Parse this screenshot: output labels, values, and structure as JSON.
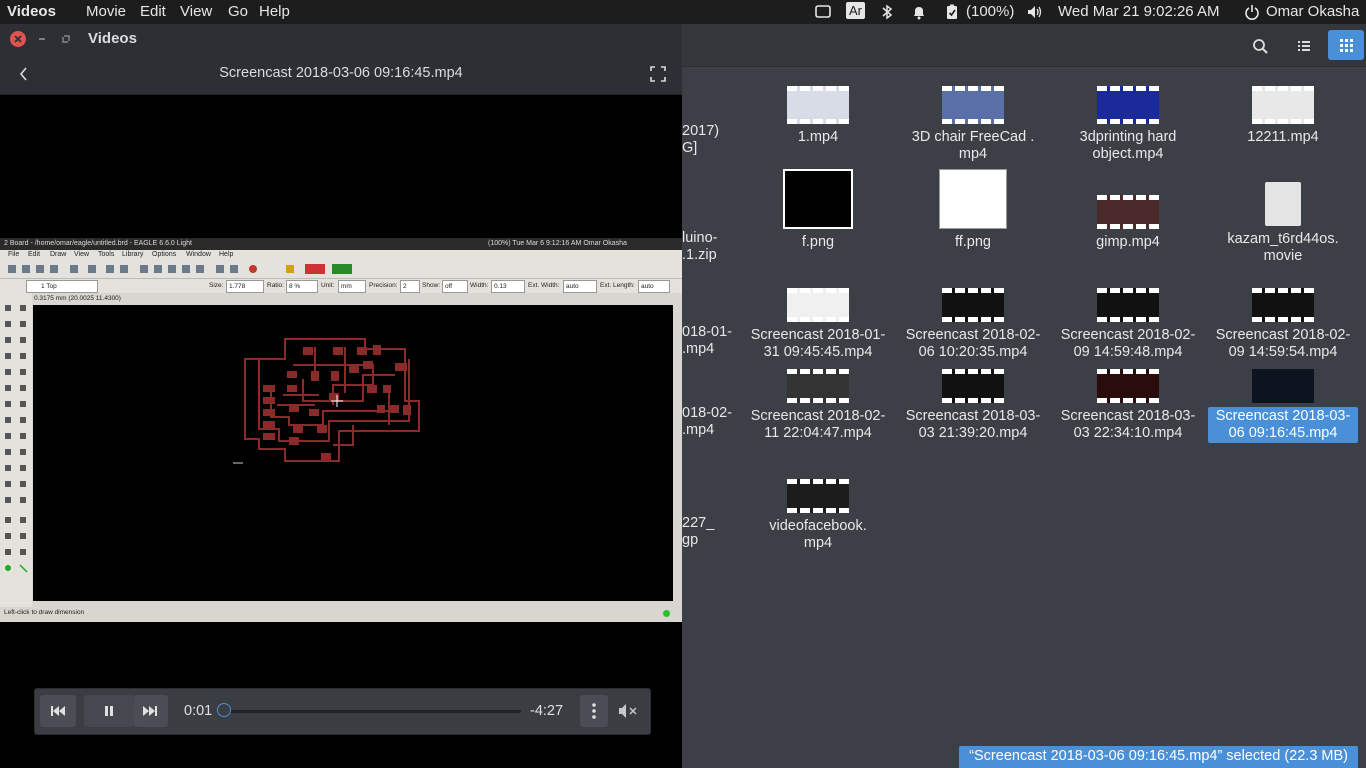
{
  "topbar": {
    "app_name": "Videos",
    "menus": [
      "Movie",
      "Edit",
      "View",
      "Go",
      "Help"
    ],
    "keyboard_layout": "Ar",
    "battery": "(100%)",
    "datetime": "Wed Mar 21  9:02:26 AM",
    "user": "Omar Okasha"
  },
  "video_window": {
    "title": "Videos",
    "file_title": "Screencast 2018-03-06 09:16:45.mp4",
    "time_current": "0:01",
    "time_remaining": "-4:27",
    "progress": 0.004
  },
  "eagle": {
    "window_title": "2 Board - /home/omar/eagle/untitled.brd - EAGLE 6.6.0 Light",
    "tray_text": "(100%)   Tue Mar  6  9:12:16 AM   Omar Okasha",
    "menus": [
      "File",
      "Edit",
      "Draw",
      "View",
      "Tools",
      "Library",
      "Options",
      "Window",
      "Help"
    ],
    "layer": "1 Top",
    "size_label": "Size:",
    "size_value": "1.778",
    "ratio_label": "Ratio:",
    "ratio_value": "8 %",
    "unit_label": "Unit:",
    "unit_value": "mm",
    "precision_label": "Precision:",
    "precision_value": "2",
    "show_label": "Show:",
    "show_value": "off",
    "width_label": "Width:",
    "width_value": "0.13",
    "ext_width_label": "Ext. Width:",
    "ext_width_value": "auto",
    "ext_length_label": "Ext. Length:",
    "ext_length_value": "auto",
    "coords": "0.3175 mm (20.0025 11.4300)",
    "hint": "Left-click to draw dimension"
  },
  "files": [
    {
      "name": "1.mp4",
      "kind": "video"
    },
    {
      "name": "3D chair FreeCad .\nmp4",
      "kind": "video"
    },
    {
      "name": "3dprinting hard\nobject.mp4",
      "kind": "video"
    },
    {
      "name": "12211.mp4",
      "kind": "video"
    },
    {
      "name": "f.png",
      "kind": "image"
    },
    {
      "name": "ff.png",
      "kind": "image"
    },
    {
      "name": "gimp.mp4",
      "kind": "video"
    },
    {
      "name": "kazam_t6rd44os.\nmovie",
      "kind": "document"
    },
    {
      "name": "Screencast 2018-01-\n31 09:45:45.mp4",
      "kind": "video"
    },
    {
      "name": "Screencast 2018-02-\n06 10:20:35.mp4",
      "kind": "video"
    },
    {
      "name": "Screencast 2018-02-\n09 14:59:48.mp4",
      "kind": "video"
    },
    {
      "name": "Screencast 2018-02-\n09 14:59:54.mp4",
      "kind": "video"
    },
    {
      "name": "Screencast 2018-02-\n11 22:04:47.mp4",
      "kind": "video"
    },
    {
      "name": "Screencast 2018-03-\n03 21:39:20.mp4",
      "kind": "video"
    },
    {
      "name": "Screencast 2018-03-\n03 22:34:10.mp4",
      "kind": "video"
    },
    {
      "name": "Screencast 2018-03-\n06 09:16:45.mp4",
      "kind": "video",
      "selected": true
    },
    {
      "name": "videofacebook.\nmp4",
      "kind": "video"
    }
  ],
  "partial_labels": [
    "2017)",
    "G]",
    "luino-",
    ".1.zip",
    "018-01-",
    ".mp4",
    "018-02-",
    ".mp4",
    "227_",
    "gp"
  ],
  "status": "“Screencast 2018-03-06 09:16:45.mp4” selected  (22.3 MB)",
  "colors": {
    "accent": "#4a90d9",
    "close": "#e0534f",
    "trace": "#8a2a2a"
  }
}
